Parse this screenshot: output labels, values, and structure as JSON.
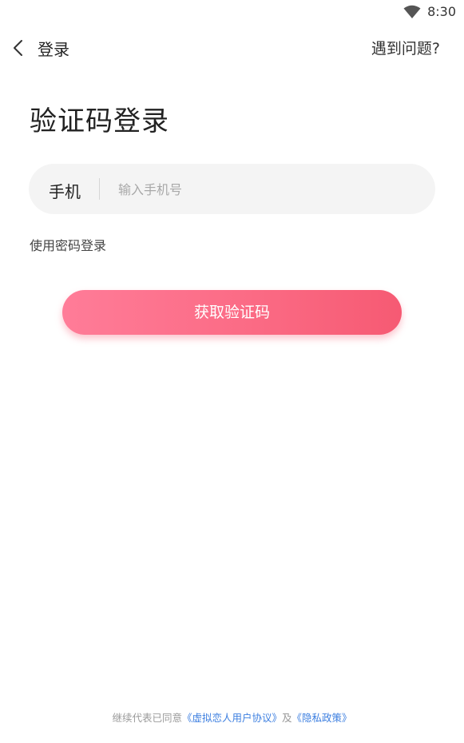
{
  "status_bar": {
    "time": "8:30",
    "wifi_icon": "wifi-icon"
  },
  "nav": {
    "back_icon": "chevron-left-icon",
    "title": "登录",
    "help": "遇到问题?"
  },
  "page_title": "验证码登录",
  "phone_field": {
    "label": "手机",
    "value": "",
    "placeholder": "输入手机号"
  },
  "password_login": "使用密码登录",
  "get_code_button": "获取验证码",
  "agreement": {
    "prefix": "继续代表已同意",
    "user_agreement": "《虚拟恋人用户协议》",
    "conjunction": "及",
    "privacy_policy": "《隐私政策》"
  },
  "colors": {
    "accent_start": "#ff7c98",
    "accent_end": "#f65a73",
    "link": "#3d7fe0",
    "field_bg": "#f4f4f4"
  }
}
